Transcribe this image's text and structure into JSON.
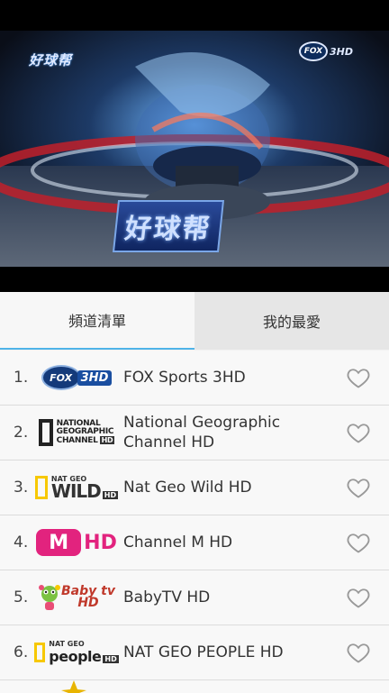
{
  "video": {
    "studio_logo": "好球帮",
    "center_sign": "好球帮",
    "channel_bug_oval": "FOX",
    "channel_bug_text": "3HD"
  },
  "tabs": [
    {
      "label": "頻道清單",
      "active": true
    },
    {
      "label": "我的最愛",
      "active": false
    }
  ],
  "channels": [
    {
      "number": "1.",
      "name": "FOX Sports 3HD",
      "logo": "fox-sports-3hd-logo",
      "logo_text": [
        "FOX",
        "3HD"
      ]
    },
    {
      "number": "2.",
      "name": "National Geographic Channel HD",
      "logo": "national-geographic-logo",
      "logo_text": [
        "NATIONAL",
        "GEOGRAPHIC",
        "CHANNEL",
        "HD"
      ]
    },
    {
      "number": "3.",
      "name": "Nat Geo Wild HD",
      "logo": "nat-geo-wild-logo",
      "logo_text": [
        "NAT GEO",
        "WILD",
        "HD"
      ]
    },
    {
      "number": "4.",
      "name": "Channel M HD",
      "logo": "channel-m-logo",
      "logo_text": [
        "M",
        "HD"
      ]
    },
    {
      "number": "5.",
      "name": "BabyTV HD",
      "logo": "babytv-logo",
      "logo_text": [
        "Baby tv",
        "HD"
      ]
    },
    {
      "number": "6.",
      "name": "NAT GEO PEOPLE HD",
      "logo": "nat-geo-people-logo",
      "logo_text": [
        "NAT GEO",
        "people",
        "HD"
      ]
    }
  ],
  "colors": {
    "tab_accent": "#4fb3e8",
    "heart_outline": "#999999"
  }
}
